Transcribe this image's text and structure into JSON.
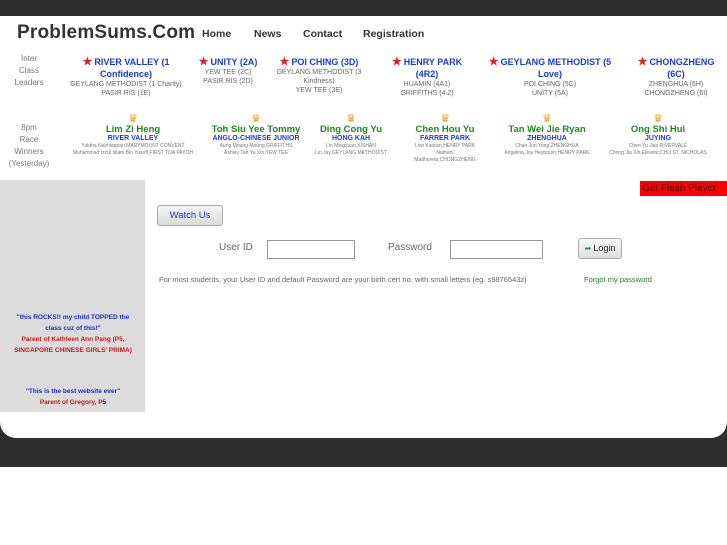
{
  "header": {
    "logo": "ProblemSums.Com",
    "nav": [
      "Home",
      "News",
      "Contact",
      "Registration"
    ]
  },
  "labels": {
    "inter_class": [
      "Inter",
      "Class",
      "Leaders"
    ],
    "race_winners": [
      "8pm",
      "Race",
      "Winners",
      "(Yesterday)"
    ]
  },
  "leaders": [
    {
      "title": "RIVER VALLEY (1 Confidence)",
      "lines": [
        "GEYLANG METHODIST (1 Charity)",
        "PASIR RIS (1E)"
      ]
    },
    {
      "title": "UNITY (2A)",
      "lines": [
        "YEW TEE (2C)",
        "PASIR RIS (2D)"
      ]
    },
    {
      "title": "POI CHING (3D)",
      "lines": [
        "GEYLANG METHODIST (3 Kindness)",
        "YEW TEE (3E)"
      ]
    },
    {
      "title": "HENRY PARK (4R2)",
      "lines": [
        "HUAMIN (4A1)",
        "GRIFFITHS (4.2)"
      ]
    },
    {
      "title": "GEYLANG METHODIST (5 Love)",
      "lines": [
        "POI CHING (5C)",
        "UNITY (5A)"
      ]
    },
    {
      "title": "CHONGZHENG (6C)",
      "lines": [
        "ZHENGHUA (6H)",
        "CHONGZHENG (6I)"
      ]
    }
  ],
  "winners": [
    {
      "name": "Lim Zi Heng",
      "school": "RIVER VALLEY",
      "others": [
        "Yuktha Nachiappan,MARYMOUNT CONVENT",
        "Muhammad Izzul Islam Bin Yusoff,FIRST TOA PAYOH"
      ]
    },
    {
      "name": "Toh Siu Yee Tommy",
      "school": "ANGLO-CHINESE JUNIOR",
      "others": [
        "Aung Moung Moung,GRIFFITHS",
        "Ashley Tan Yu Xin,YEW TEE"
      ]
    },
    {
      "name": "Ding Cong Yu",
      "school": "HONG KAH",
      "others": [
        "Lin Mingxuan,XISHAN",
        "Lin Jay,GEYLANG METHODIST"
      ]
    },
    {
      "name": "Chen Hou Yu",
      "school": "FARRER PARK",
      "others": [
        "Low Kaixian,HENRY PARK",
        "Nathani Madhureta,CHONGZHENG"
      ]
    },
    {
      "name": "Tan Wei Jie Ryan",
      "school": "ZHENGHUA",
      "others": [
        "Chan Jun Yong,ZHENGHUA",
        "Angelina Joy Heybourn,HENRY PARK"
      ]
    },
    {
      "name": "Ong Shi Hui",
      "school": "JUYING",
      "others": [
        "Chen Yu Jiao,RIVERVALE",
        "Chong Jia Xin,Eleanor,CHIJ ST. NICHOLAS"
      ]
    }
  ],
  "testimonials": [
    {
      "quote": "\"this ROCKS!! my child TOPPED the class cuz of this!\"",
      "author": "Parent of Kathleen Ann Pang (P5, SINGAPORE CHINESE GIRLS' PRIMA)"
    },
    {
      "quote": "\"This is the best website ever\"",
      "author": "Parent of Gregory, P5"
    }
  ],
  "flash_banner": "Get Flash Player",
  "watch_button": "Watch Us",
  "login": {
    "userid_label": "User ID",
    "password_label": "Password",
    "userid_value": "",
    "password_value": "",
    "button": "Login",
    "hint": "For most students, your User ID and default Password are your birth cert no. with small letters (eg. s9876543z)",
    "forgot": "Forgot my password"
  },
  "colors": {
    "page_dark": "#2e2e2e",
    "leader_blue": "#1a3ad6",
    "winner_green": "#1b8a1b",
    "star_red": "#e02020",
    "flash_red": "#ff0000"
  }
}
